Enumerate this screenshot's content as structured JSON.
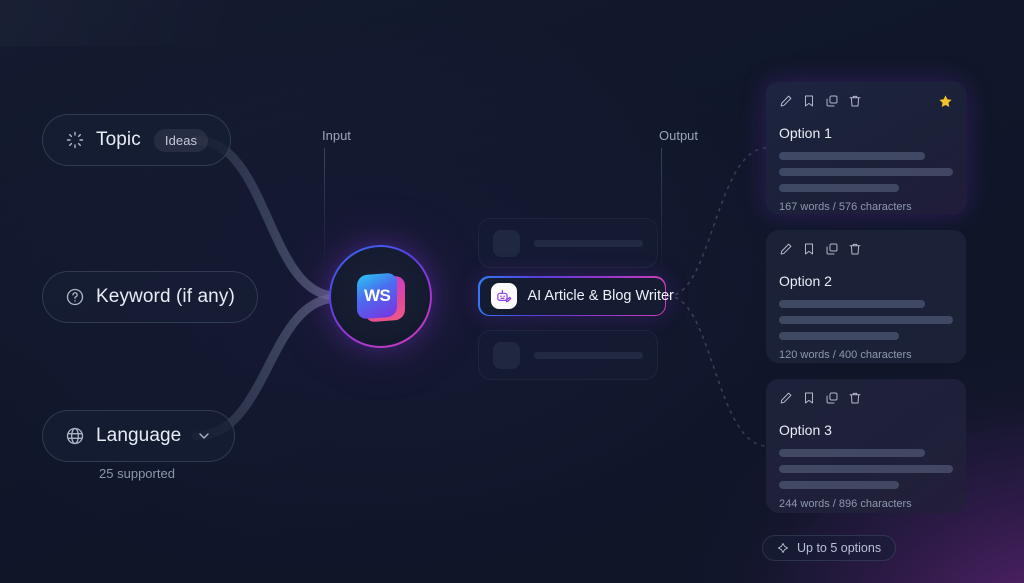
{
  "theme": {
    "background": "#10172a",
    "card": "#1b2238",
    "accent_blue": "#2f7df6",
    "accent_purple": "#8e36cf",
    "accent_magenta": "#d03fb3",
    "star": "#f5bf2e",
    "text": "#e9edf6",
    "muted": "#8e98ae"
  },
  "inputs": {
    "section_label": "Input",
    "pills": [
      {
        "icon": "sparkle-icon",
        "label": "Topic",
        "badge": "Ideas"
      },
      {
        "icon": "help-circle-icon",
        "label": "Keyword (if any)",
        "badge": ""
      },
      {
        "icon": "globe-icon",
        "label": "Language",
        "badge": ""
      }
    ],
    "language_note": "25 supported"
  },
  "node": {
    "logo_text": "WS",
    "logo_name": "ws-logo"
  },
  "tools": {
    "selected": {
      "icon": "robot-write-icon",
      "label": "AI Article & Blog Writer"
    }
  },
  "outputs": {
    "section_label": "Output",
    "cards": [
      {
        "title": "Option 1",
        "meta": "167 words / 576 characters",
        "featured": true,
        "starred": true
      },
      {
        "title": "Option 2",
        "meta": "120 words / 400 characters",
        "featured": false,
        "starred": false
      },
      {
        "title": "Option 3",
        "meta": "244 words / 896 characters",
        "featured": false,
        "starred": false
      }
    ],
    "card_actions": [
      "edit-icon",
      "bookmark-icon",
      "copy-icon",
      "trash-icon"
    ],
    "footer": {
      "icon": "sparkle-diamond-icon",
      "label": "Up to 5 options"
    }
  }
}
